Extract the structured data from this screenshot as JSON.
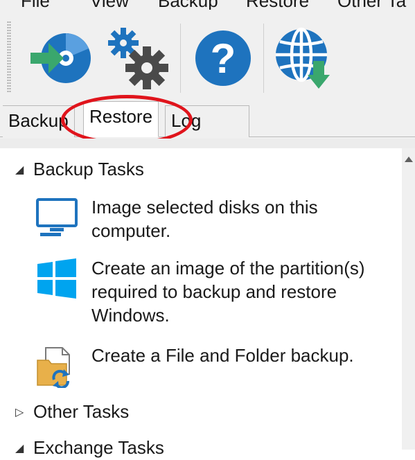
{
  "menu": {
    "items": [
      "File",
      "View",
      "Backup",
      "Restore",
      "Other Ta"
    ]
  },
  "toolbar": {
    "buttons": [
      {
        "name": "backup-disk",
        "icon": "disk-backup-icon"
      },
      {
        "name": "settings",
        "icon": "gears-icon"
      },
      {
        "name": "help",
        "icon": "help-icon"
      },
      {
        "name": "download-update",
        "icon": "globe-download-icon"
      }
    ]
  },
  "tabs": [
    {
      "label": "Backup",
      "active": false
    },
    {
      "label": "Restore",
      "active": true
    },
    {
      "label": "Log",
      "active": false
    }
  ],
  "groups": {
    "backup_tasks": {
      "label": "Backup Tasks",
      "expanded": true,
      "tasks": [
        {
          "icon": "monitor-icon",
          "label": "Image selected disks on this computer."
        },
        {
          "icon": "windows-logo-icon",
          "label": "Create an image of the partition(s) required to backup and restore Windows."
        },
        {
          "icon": "file-folder-backup-icon",
          "label": "Create a File and Folder backup."
        }
      ]
    },
    "other_tasks": {
      "label": "Other Tasks",
      "expanded": false
    },
    "exchange_tasks": {
      "label": "Exchange Tasks",
      "expanded": true
    }
  },
  "colors": {
    "highlight": "#e0141c",
    "accent_blue": "#1e73be",
    "windows_blue": "#00a4ef",
    "green": "#3aa76d"
  }
}
